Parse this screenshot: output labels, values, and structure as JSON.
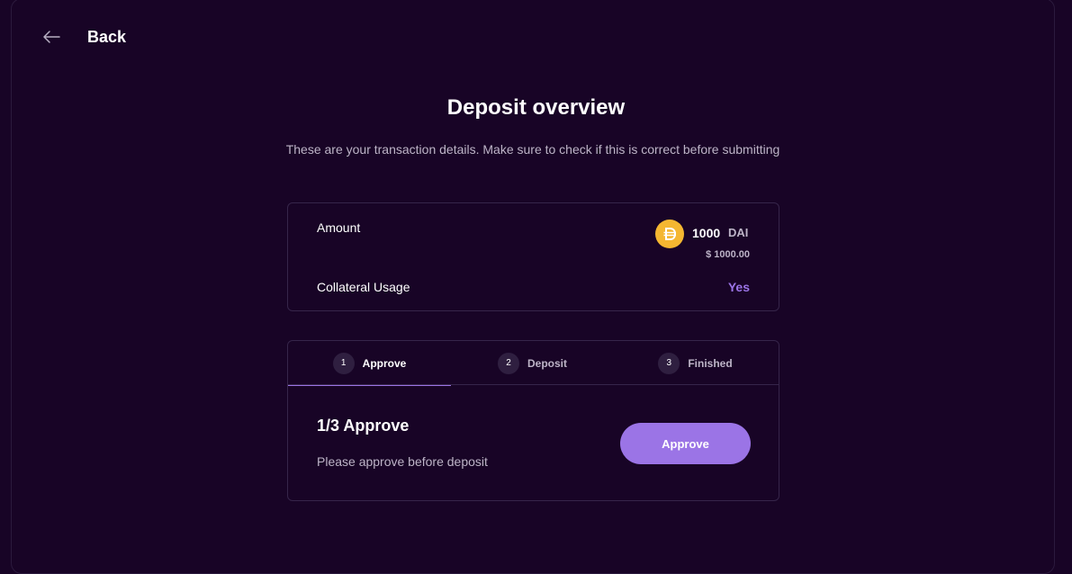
{
  "header": {
    "back_label": "Back",
    "back_icon": "arrow-left-icon"
  },
  "page": {
    "title": "Deposit overview",
    "subtitle": "These are your transaction details. Make sure to check if this is correct before submitting"
  },
  "overview": {
    "amount_label": "Amount",
    "token_icon": "dai-token-icon",
    "amount_value": "1000",
    "amount_unit": "DAI",
    "amount_usd": "$ 1000.00",
    "collateral_label": "Collateral Usage",
    "collateral_value": "Yes"
  },
  "steps": {
    "tabs": [
      {
        "number": "1",
        "label": "Approve",
        "active": true
      },
      {
        "number": "2",
        "label": "Deposit",
        "active": false
      },
      {
        "number": "3",
        "label": "Finished",
        "active": false
      }
    ],
    "current_title": "1/3 Approve",
    "current_description": "Please approve before deposit",
    "action_label": "Approve"
  },
  "colors": {
    "background": "#180426",
    "accent": "#9b74e6",
    "token": "#f4b731",
    "muted_text": "#bdb4c7",
    "border": "#36254a"
  }
}
